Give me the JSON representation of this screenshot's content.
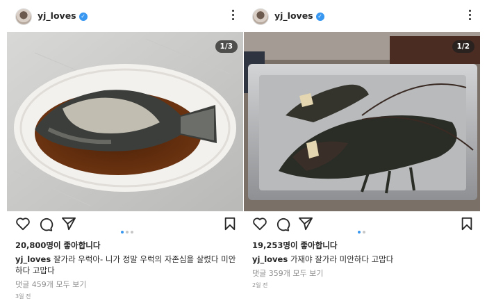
{
  "posts": [
    {
      "username": "yj_loves",
      "counter": "1/3",
      "likes": "20,800명이 좋아합니다",
      "caption_user": "yj_loves",
      "caption_text": " 잘가라 우럭아-  니가 정말 우럭의 자존심을 살렸다 미안하다 고맙다",
      "comments": "댓글 459개 모두 보기",
      "time": "3일 전",
      "carousel": {
        "total": 3,
        "active": 0
      }
    },
    {
      "username": "yj_loves",
      "counter": "1/2",
      "likes": "19,253명이 좋아합니다",
      "caption_user": "yj_loves",
      "caption_text": " 가재야 잘가라 미안하다 고맙다",
      "comments": "댓글 359개 모두 보기",
      "time": "2일 전",
      "carousel": {
        "total": 2,
        "active": 0
      }
    }
  ],
  "icons": [
    "avatar",
    "verified-icon",
    "more-icon",
    "heart-icon",
    "comment-icon",
    "share-icon",
    "bookmark-icon"
  ],
  "colors": {
    "accent": "#3897f0",
    "text": "#262626",
    "muted": "#8e8e8e",
    "dot_inactive": "#c7c7c7"
  }
}
